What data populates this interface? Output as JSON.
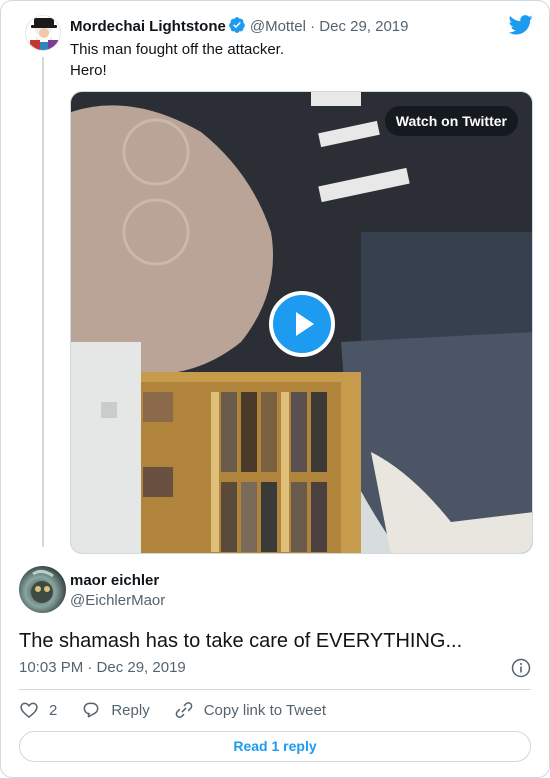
{
  "quoted_tweet": {
    "author_name": "Mordechai Lightstone",
    "handle": "@Mottel",
    "separator": "·",
    "date": "Dec 29, 2019",
    "text_line1": "This man fought off the attacker.",
    "text_line2": "Hero!",
    "video": {
      "watch_label": "Watch on Twitter"
    }
  },
  "tweet": {
    "author_name": "maor eichler",
    "handle": "@EichlerMaor",
    "text": "The shamash has to take care of EVERYTHING...",
    "timestamp": "10:03 PM · Dec 29, 2019"
  },
  "actions": {
    "like_count": "2",
    "reply_label": "Reply",
    "copy_link_label": "Copy link to Tweet"
  },
  "read_replies_label": "Read 1 reply",
  "colors": {
    "accent": "#1d9bf0",
    "text": "#0f1419",
    "muted": "#536471",
    "border": "#cfd9de"
  },
  "icons": [
    "twitter-bird-icon",
    "verified-badge-icon",
    "play-icon",
    "info-icon",
    "heart-icon",
    "reply-icon",
    "link-icon"
  ]
}
